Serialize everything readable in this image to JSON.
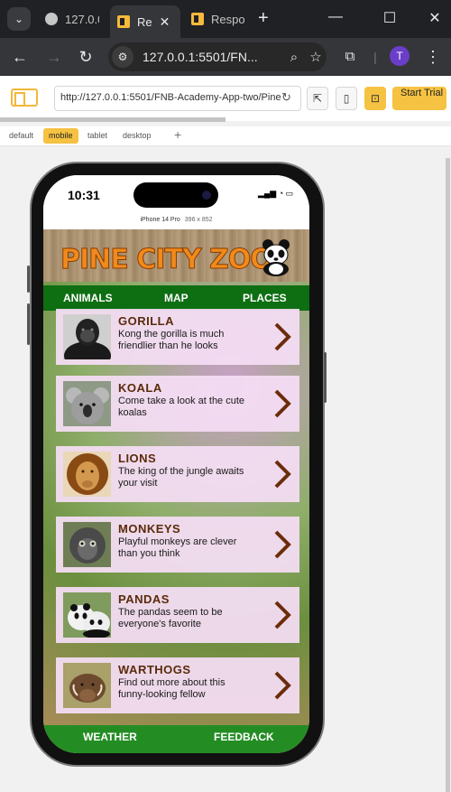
{
  "browser": {
    "tabs": [
      {
        "label": "127.0.0",
        "active": false
      },
      {
        "label": "Re",
        "active": true
      },
      {
        "label": "Respo",
        "active": false
      }
    ],
    "url": "127.0.0.1:5501/FN...",
    "profile_initial": "T"
  },
  "extension": {
    "url": "http://127.0.0.1:5501/FNB-Academy-App-two/Pine",
    "trial_label": "Start Trial",
    "device_tabs": [
      "default",
      "mobile",
      "tablet",
      "desktop"
    ],
    "active_device_tab": "mobile"
  },
  "device": {
    "time": "10:31",
    "name": "iPhone 14 Pro",
    "size": "396 x 852"
  },
  "app": {
    "title": "PINE CITY ZOO",
    "top_nav": [
      "ANIMALS",
      "MAP",
      "PLACES"
    ],
    "animals": [
      {
        "name": "GORILLA",
        "desc": "Kong the gorilla is much friendlier than he looks",
        "icon": "gorilla-photo"
      },
      {
        "name": "KOALA",
        "desc": "Come take a look at the cute koalas",
        "icon": "koala-photo"
      },
      {
        "name": "LIONS",
        "desc": "The king of the jungle awaits your visit",
        "icon": "lion-photo"
      },
      {
        "name": "MONKEYS",
        "desc": "Playful monkeys are clever than you think",
        "icon": "monkey-photo"
      },
      {
        "name": "PANDAS",
        "desc": "The pandas seem to be everyone's favorite",
        "icon": "panda-photo"
      },
      {
        "name": "WARTHOGS",
        "desc": "Find out more about this funny-looking fellow",
        "icon": "warthog-photo"
      }
    ],
    "bottom_nav": [
      "WEATHER",
      "FEEDBACK"
    ]
  },
  "colors": {
    "nav_green": "#0e6e12",
    "bottom_green": "#238d23",
    "title_orange": "#f08a1c",
    "card_bg": "#f5def5",
    "card_title": "#5a2a0a",
    "accent_yellow": "#f5c242"
  }
}
